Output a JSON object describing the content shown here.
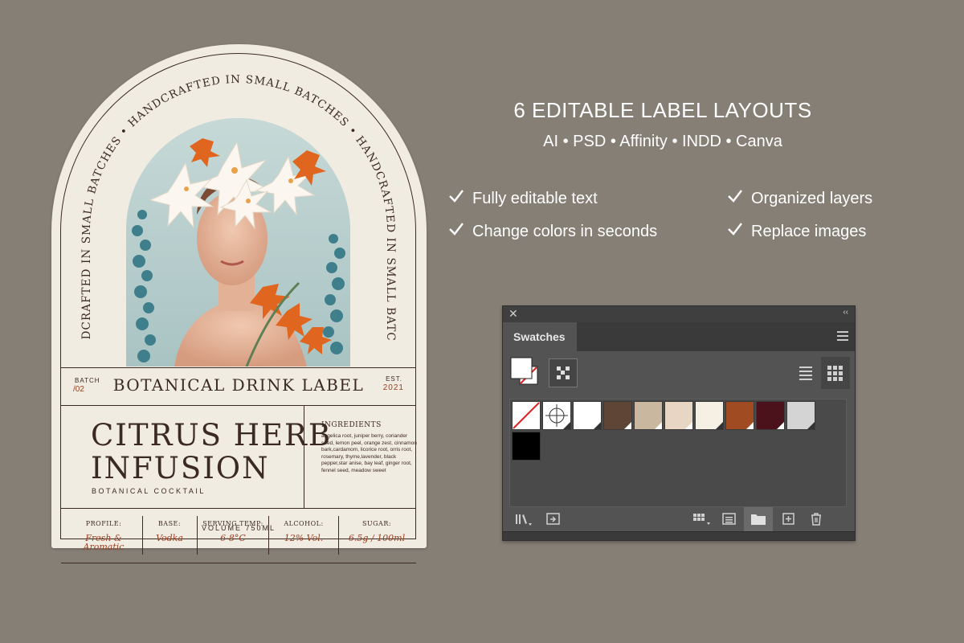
{
  "label": {
    "arc_text": "HANDCRAFTED IN SMALL BATCHES • HANDCRAFTED IN SMALL BATCHES • HANDCRAFTED IN SMALL BATCHES",
    "batch_label": "BATCH",
    "batch_value": "/02",
    "title": "BOTANICAL DRINK LABEL",
    "est_label": "EST.",
    "est_value": "2021",
    "product_line1": "CITRUS HERB",
    "product_line2": "INFUSION",
    "product_sub": "BOTANICAL COCKTAIL",
    "ingredients_title": "INGREDIENTS",
    "ingredients": "angelica root, juniper berry, coriander seed, lemon peel, orange zest, cinnamon bark,cardamom, licorice root, orris root, rosemary, thyme,lavender, black pepper,star anise, bay leaf, ginger root, fennel seed, meadow sweet",
    "attributes": [
      {
        "key": "PROFILE:",
        "value": "Fresh & Aromatic"
      },
      {
        "key": "BASE:",
        "value": "Vodka"
      },
      {
        "key": "SERVING TEMP:",
        "value": "6-8°C"
      },
      {
        "key": "ALCOHOL:",
        "value": "12% Vol."
      },
      {
        "key": "SUGAR:",
        "value": "6.5g / 100ml"
      }
    ],
    "volume": "VOLUME 750ML",
    "colors": {
      "paper": "#f1ece1",
      "ink": "#3b2a23",
      "accent": "#9b3f22"
    }
  },
  "promo": {
    "heading": "6 EDITABLE LABEL LAYOUTS",
    "formats": "AI • PSD • Affinity • INDD • Canva",
    "features": [
      "Fully editable text",
      "Organized layers",
      "Change colors in seconds",
      "Replace images"
    ],
    "check_icon": "checkmark-icon"
  },
  "swatches_panel": {
    "tab": "Swatches",
    "close_icon": "close-icon",
    "collapse_icon": "collapse-icon",
    "menu_icon": "panel-menu-icon",
    "swatches": [
      {
        "name": "None",
        "color": "none"
      },
      {
        "name": "Registration",
        "color": "registration"
      },
      {
        "name": "Paper",
        "color": "#ffffff"
      },
      {
        "name": "Brown",
        "color": "#5f4536"
      },
      {
        "name": "Tan",
        "color": "#c9b7a0"
      },
      {
        "name": "Sand",
        "color": "#e6d6c3"
      },
      {
        "name": "Cream",
        "color": "#f6efe4"
      },
      {
        "name": "Rust",
        "color": "#a04b22"
      },
      {
        "name": "Burgundy",
        "color": "#4b121b"
      },
      {
        "name": "Light Gray",
        "color": "#d4d4d4"
      },
      {
        "name": "Black",
        "color": "#000000"
      }
    ],
    "bottom_icons": [
      "swatch-libraries-icon",
      "place-swatches-icon",
      "show-kinds-icon",
      "swatch-options-icon",
      "new-group-icon",
      "new-swatch-icon",
      "delete-icon"
    ]
  }
}
